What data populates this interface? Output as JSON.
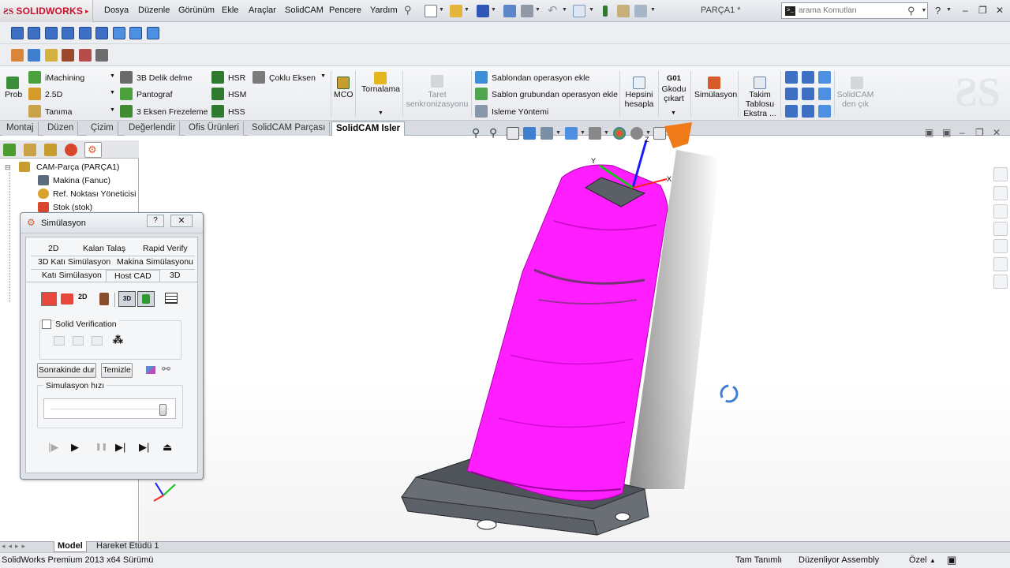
{
  "app": {
    "logo_text": "SOLIDWORKS",
    "document_title": "PARÇA1 *"
  },
  "menu": [
    "Dosya",
    "Düzenle",
    "Görünüm",
    "Ekle",
    "Araçlar",
    "SolidCAM",
    "Pencere",
    "Yardım"
  ],
  "search": {
    "placeholder": "arama Komutları"
  },
  "ribbon": {
    "prob": "Prob",
    "imachining": "iMachining",
    "d25": "2.5D",
    "tanima": "Tanıma",
    "delik": "3B Delik delme",
    "pantograf": "Pantograf",
    "eksen3": "3 Eksen Frezeleme",
    "hsr": "HSR",
    "hsm": "HSM",
    "hss": "HSS",
    "coklu": "Çoklu Eksen",
    "mco": "MCO",
    "tornalama": "Tornalama",
    "taret_l1": "Taret",
    "taret_l2": "senkronizasyonu",
    "sablon1": "Sablondan operasyon ekle",
    "sablon2": "Sablon grubundan operasyon ekle",
    "isleme": "Isleme Yöntemi",
    "hepsini_l1": "Hepsini",
    "hepsini_l2": "hesapla",
    "g01": "G01",
    "gkodu_l1": "Gkodu",
    "gkodu_l2": "çıkart",
    "simulasyon": "Simülasyon",
    "takim_l1": "Takim",
    "takim_l2": "Tablosu",
    "takim_l3": "Ekstra ...",
    "solidcam_l1": "SolidCAM",
    "solidcam_l2": "den çık"
  },
  "tabs": [
    "Montaj",
    "Düzen",
    "Çizim",
    "Değerlendir",
    "Ofis Ürünleri",
    "SolidCAM Parçası",
    "SolidCAM Isler"
  ],
  "tree": {
    "root": "CAM-Parça (PARÇA1)",
    "items": [
      "Makina (Fanuc)",
      "Ref. Noktası Yöneticisi",
      "Stok (stok)"
    ]
  },
  "dialog": {
    "title": "Simülasyon",
    "help": "?",
    "tabs_row1": [
      "2D",
      "Kalan Talaş",
      "Rapid Verify"
    ],
    "tabs_row2": [
      "3D Katı Simülasyon",
      "Makina Simülasyonu"
    ],
    "tabs_row3": [
      "Katı Simülasyon",
      "Host CAD",
      "3D"
    ],
    "solid_verification": "Solid Verification",
    "stop_next": "Sonrakinde dur",
    "clear": "Temizle",
    "speed_label": "Simulasyon hızı",
    "speed": 0.95
  },
  "bottom_tabs": [
    "Model",
    "Hareket Etüdü 1"
  ],
  "status": {
    "left": "SolidWorks Premium 2013 x64 Sürümü",
    "defined": "Tam Tanımlı",
    "editing": "Düzenliyor Assembly",
    "custom": "Özel"
  },
  "colors": {
    "toolpath": "#ff1eff",
    "stock": "#5b5f66",
    "brand": "#c8102e"
  }
}
